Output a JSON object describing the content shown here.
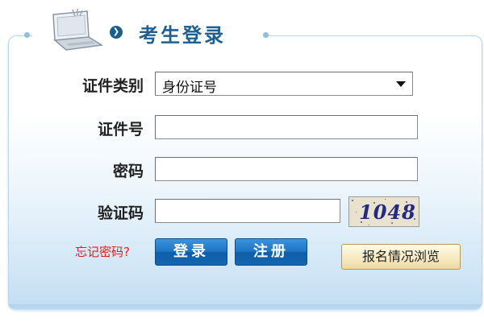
{
  "header": {
    "title": "考生登录",
    "bullet": "❯"
  },
  "form": {
    "id_type": {
      "label": "证件类别",
      "selected": "身份证号"
    },
    "id_number": {
      "label": "证件号",
      "value": ""
    },
    "password": {
      "label": "密码",
      "value": ""
    },
    "captcha": {
      "label": "验证码",
      "value": "",
      "image_text": "1048"
    }
  },
  "actions": {
    "forgot_password": "忘记密码?",
    "login": "登录",
    "register": "注册",
    "browse": "报名情况浏览"
  },
  "icons": {
    "header_icon": "laptop-icon",
    "header_bullet": "circle-chevron-icon",
    "dropdown": "chevron-down-icon"
  },
  "colors": {
    "title": "#1f5f8f",
    "button_blue": "#1d74c4",
    "forgot_link": "#e32020",
    "panel_border": "#b9d6ea"
  }
}
